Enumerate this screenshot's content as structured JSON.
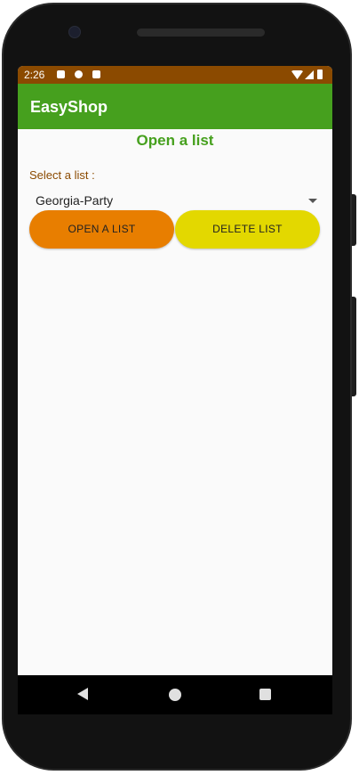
{
  "status_bar": {
    "time": "2:26",
    "left_icons": [
      "a-icon",
      "record-icon",
      "sd-card-icon"
    ],
    "right_icons": [
      "wifi-icon",
      "signal-icon",
      "battery-icon"
    ]
  },
  "app_bar": {
    "title": "EasyShop"
  },
  "main": {
    "page_title": "Open a list",
    "select_label": "Select a list :",
    "selected_list": "Georgia-Party",
    "open_button_label": "OPEN A LIST",
    "delete_button_label": "DELETE LIST"
  },
  "nav": {
    "icons": [
      "back-icon",
      "home-icon",
      "recents-icon"
    ]
  },
  "colors": {
    "status_bar": "#8b4a00",
    "app_bar": "#46a01e",
    "title_accent": "#46a01e",
    "label_accent": "#8b4a00",
    "open_button": "#e87e00",
    "delete_button": "#e3d800"
  }
}
